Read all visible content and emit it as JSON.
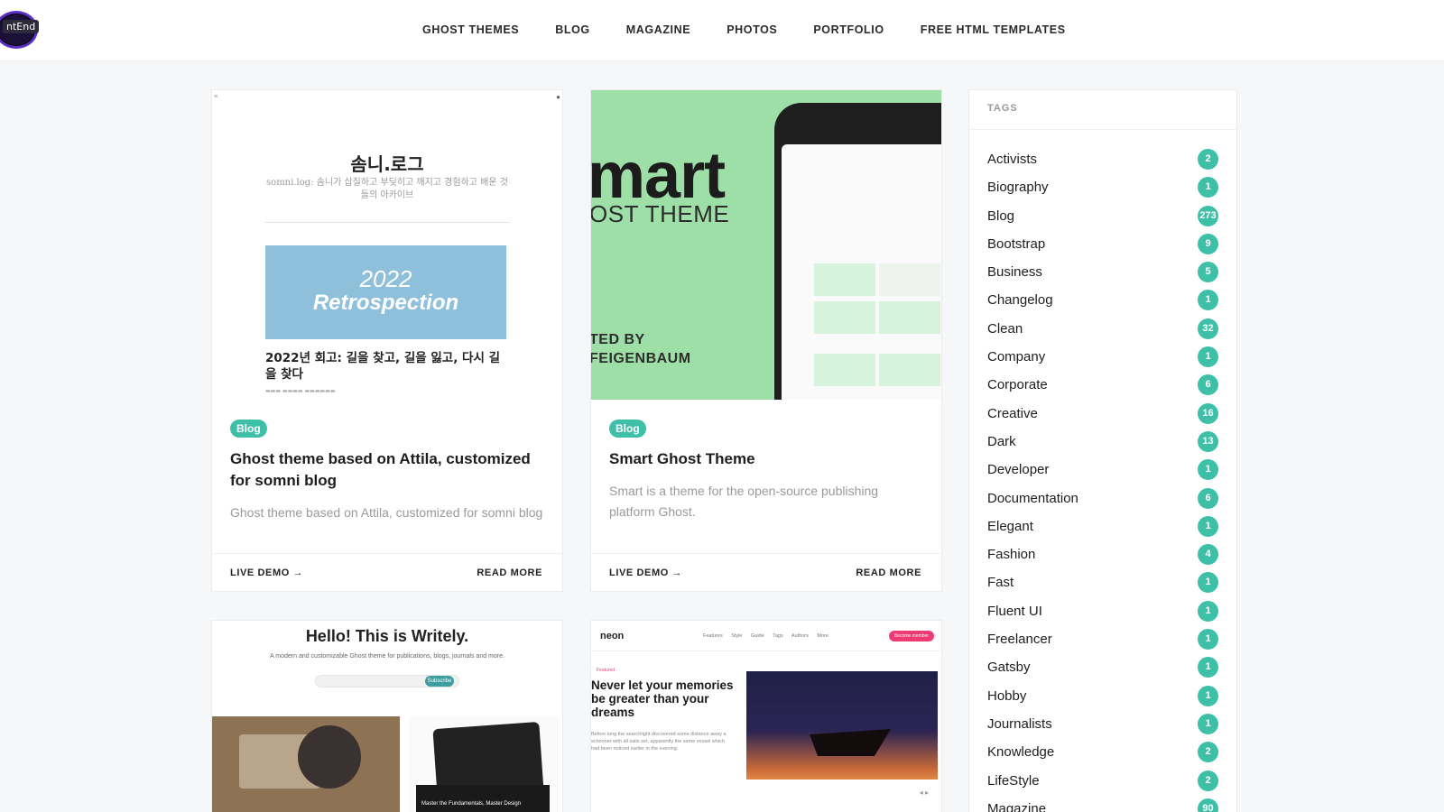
{
  "header": {
    "logo_text": "ntEnd",
    "nav": [
      "GHOST THEMES",
      "BLOG",
      "MAGAZINE",
      "PHOTOS",
      "PORTFOLIO",
      "FREE HTML TEMPLATES"
    ]
  },
  "cards": [
    {
      "tag": "Blog",
      "title": "Ghost theme based on Attila, customized for somni blog",
      "excerpt": "Ghost theme based on Attila, customized for somni blog",
      "live_demo": "LIVE DEMO →",
      "read_more": "READ MORE",
      "thumb": {
        "site_title": "솜니.로그",
        "site_subtitle": "somni.log: 솜니가 삽질하고 부딪히고 깨지고 경험하고 배운 것들의 아카이브",
        "banner_year": "2022",
        "banner_word": "Retrospection",
        "post_title": "2022년 회고: 길을 찾고, 길을 잃고, 다시 길을 찾다"
      }
    },
    {
      "tag": "Blog",
      "title": "Smart Ghost Theme",
      "excerpt": "Smart is a theme for the open-source publishing platform Ghost.",
      "live_demo": "LIVE DEMO →",
      "read_more": "READ MORE",
      "thumb": {
        "big": "mart",
        "sub": "OST THEME",
        "by1": "TED BY",
        "by2": "FEIGENBAUM"
      }
    },
    {
      "thumb": {
        "title": "Hello! This is Writely.",
        "subtitle": "A modern and customizable Ghost theme for publications, blogs, journals and more.",
        "input_placeholder": "Your email address",
        "button": "Subscribe",
        "caption": "Master the Fundamentals, Master Design"
      }
    },
    {
      "thumb": {
        "logo": "neon",
        "nav": "Features Style Guide Tags Authors More",
        "button": "Become member",
        "featured": "Featured",
        "headline": "Never let your memories be greater than your dreams",
        "copy": "Before long the searchlight discovered some distance away a schooner with all sails set, apparently the same vessel which had been noticed earlier in the evening."
      }
    }
  ],
  "sidebar": {
    "heading": "TAGS",
    "tags": [
      {
        "name": "Activists",
        "count": "2"
      },
      {
        "name": "Biography",
        "count": "1"
      },
      {
        "name": "Blog",
        "count": "273"
      },
      {
        "name": "Bootstrap",
        "count": "9"
      },
      {
        "name": "Business",
        "count": "5"
      },
      {
        "name": "Changelog",
        "count": "1"
      },
      {
        "name": "Clean",
        "count": "32"
      },
      {
        "name": "Company",
        "count": "1"
      },
      {
        "name": "Corporate",
        "count": "6"
      },
      {
        "name": "Creative",
        "count": "16"
      },
      {
        "name": "Dark",
        "count": "13"
      },
      {
        "name": "Developer",
        "count": "1"
      },
      {
        "name": "Documentation",
        "count": "6"
      },
      {
        "name": "Elegant",
        "count": "1"
      },
      {
        "name": "Fashion",
        "count": "4"
      },
      {
        "name": "Fast",
        "count": "1"
      },
      {
        "name": "Fluent UI",
        "count": "1"
      },
      {
        "name": "Freelancer",
        "count": "1"
      },
      {
        "name": "Gatsby",
        "count": "1"
      },
      {
        "name": "Hobby",
        "count": "1"
      },
      {
        "name": "Journalists",
        "count": "1"
      },
      {
        "name": "Knowledge",
        "count": "2"
      },
      {
        "name": "LifeStyle",
        "count": "2"
      },
      {
        "name": "Magazine",
        "count": "90"
      }
    ]
  },
  "colors": {
    "accent": "#3dbfa8",
    "background": "#f6f7f8",
    "neon_accent": "#ee3b74",
    "smart_green": "#9edfa7"
  }
}
